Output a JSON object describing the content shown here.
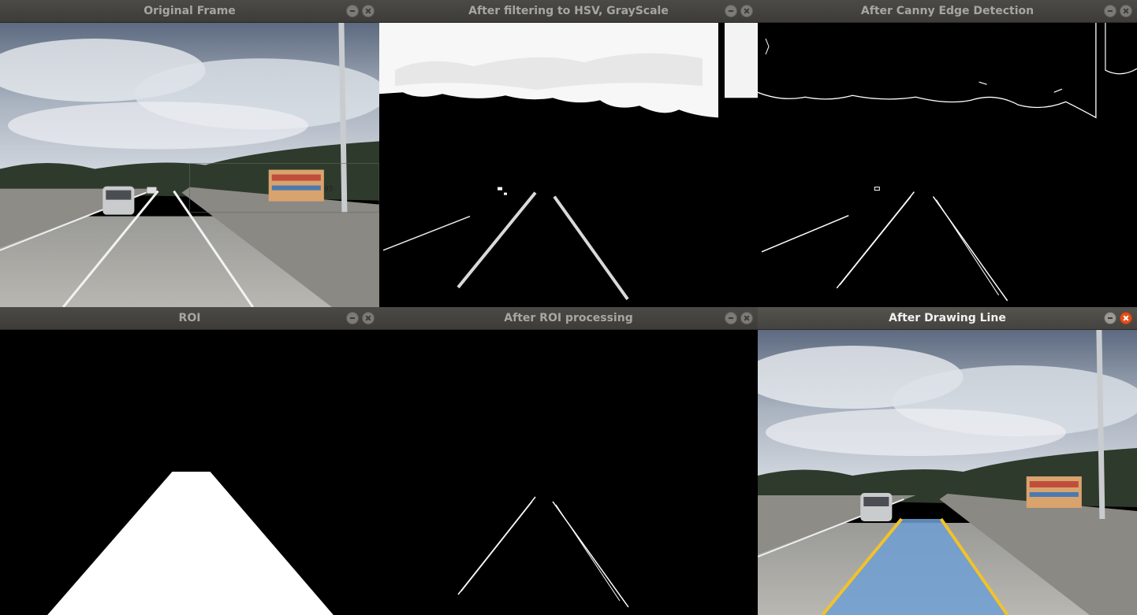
{
  "windows": {
    "original": {
      "title": "Original Frame"
    },
    "hsv": {
      "title": "After filtering to HSV, GrayScale"
    },
    "canny": {
      "title": "After Canny Edge Detection"
    },
    "roi": {
      "title": "ROI"
    },
    "roi_processed": {
      "title": "After ROI processing"
    },
    "drawn": {
      "title": "After Drawing Line"
    }
  },
  "scene": {
    "sign_number": "93\n8"
  },
  "colors": {
    "lane_line": "#f2c22a",
    "lane_fill": "#6e9fd3",
    "close_active": "#e0501e"
  }
}
